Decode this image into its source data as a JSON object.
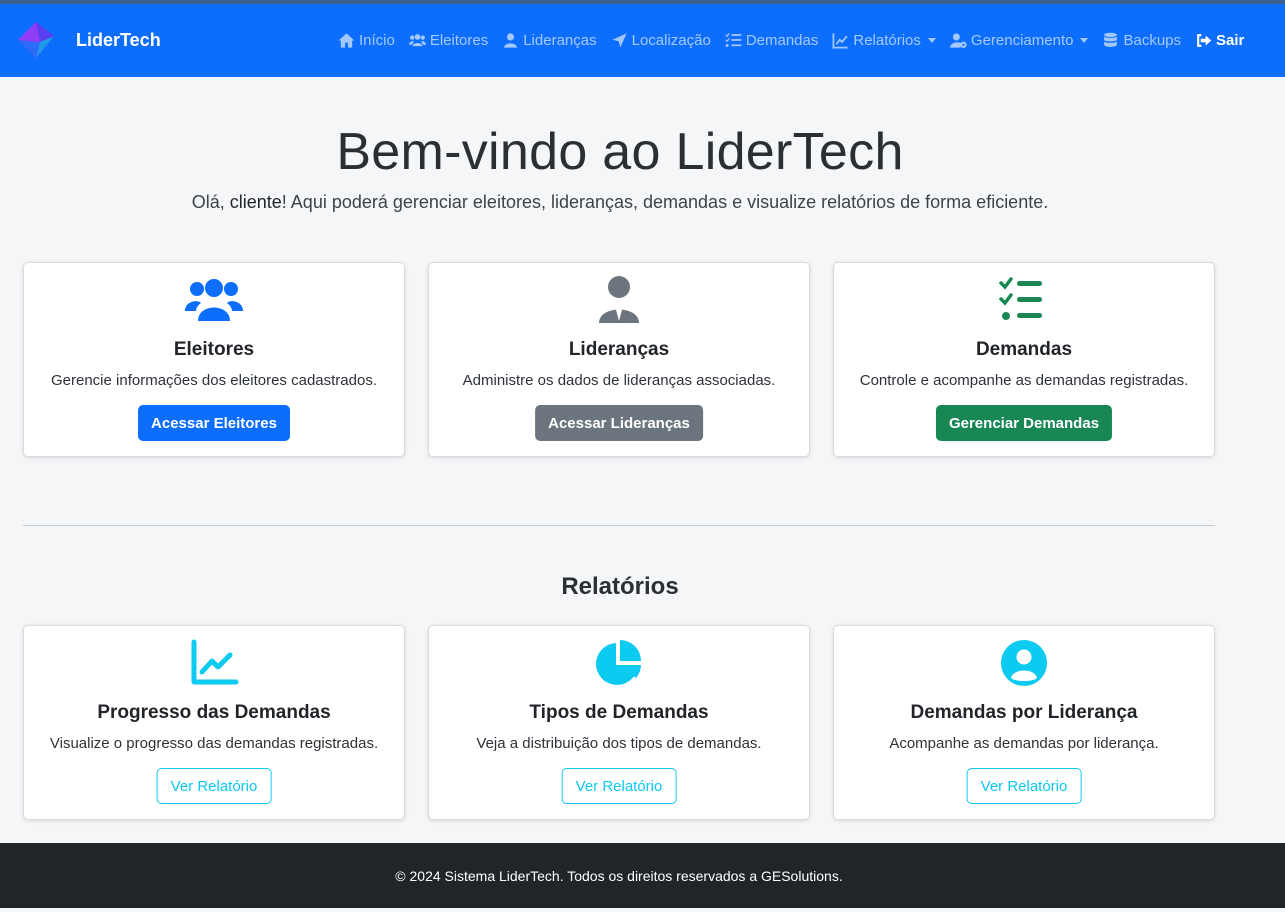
{
  "app": {
    "name": "LiderTech"
  },
  "nav": {
    "items": [
      {
        "label": "Início",
        "icon": "home-icon"
      },
      {
        "label": "Eleitores",
        "icon": "users-icon"
      },
      {
        "label": "Lideranças",
        "icon": "user-icon"
      },
      {
        "label": "Localização",
        "icon": "location-arrow-icon"
      },
      {
        "label": "Demandas",
        "icon": "list-check-icon"
      },
      {
        "label": "Relatórios",
        "icon": "chart-line-icon",
        "dropdown": true
      },
      {
        "label": "Gerenciamento",
        "icon": "user-gear-icon",
        "dropdown": true
      },
      {
        "label": "Backups",
        "icon": "database-icon"
      },
      {
        "label": "Sair",
        "icon": "sign-out-icon"
      }
    ]
  },
  "hero": {
    "title": "Bem-vindo ao LiderTech",
    "greeting_prefix": "Olá, ",
    "user": "cliente",
    "greeting_suffix": "! Aqui poderá gerenciar eleitores, lideranças, demandas e visualize relatórios de forma eficiente."
  },
  "cards": [
    {
      "title": "Eleitores",
      "description": "Gerencie informações dos eleitores cadastrados.",
      "button": "Acessar Eleitores",
      "icon": "users-icon",
      "color": "#0d6efd"
    },
    {
      "title": "Lideranças",
      "description": "Administre os dados de lideranças associadas.",
      "button": "Acessar Lideranças",
      "icon": "user-tie-icon",
      "color": "#6c757d"
    },
    {
      "title": "Demandas",
      "description": "Controle e acompanhe as demandas registradas.",
      "button": "Gerenciar Demandas",
      "icon": "list-check-icon",
      "color": "#198754"
    }
  ],
  "reports": {
    "title": "Relatórios",
    "cards": [
      {
        "title": "Progresso das Demandas",
        "description": "Visualize o progresso das demandas registradas.",
        "button": "Ver Relatório",
        "icon": "chart-line-icon",
        "color": "#0dcaf0"
      },
      {
        "title": "Tipos de Demandas",
        "description": "Veja a distribuição dos tipos de demandas.",
        "button": "Ver Relatório",
        "icon": "chart-pie-icon",
        "color": "#0dcaf0"
      },
      {
        "title": "Demandas por Liderança",
        "description": "Acompanhe as demandas por liderança.",
        "button": "Ver Relatório",
        "icon": "user-circle-icon",
        "color": "#0dcaf0"
      }
    ]
  },
  "footer": {
    "text": "© 2024 Sistema LiderTech. Todos os direitos reservados a GESolutions."
  }
}
